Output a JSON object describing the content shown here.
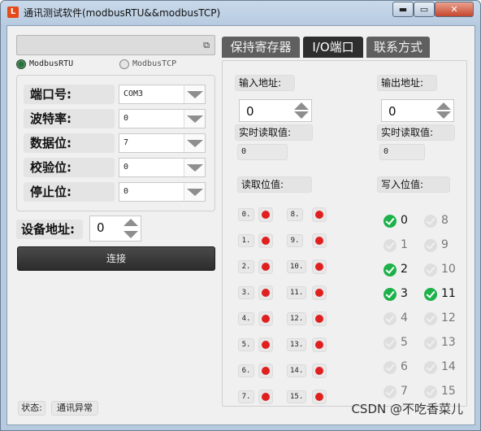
{
  "window": {
    "icon_glyph": "L",
    "title": "通讯测试软件(modbusRTU&&modbusTCP)",
    "min_glyph": "▬",
    "max_glyph": "▭",
    "close_glyph": "✕"
  },
  "left": {
    "combo_icon": "restore-icon",
    "restore_glyph": "⧉",
    "radios": {
      "rtu": "ModbusRTU",
      "tcp": "ModbusTCP",
      "selected": "ModbusRTU"
    },
    "serial": [
      {
        "label": "端口号:",
        "value": "COM3"
      },
      {
        "label": "波特率:",
        "value": "0"
      },
      {
        "label": "数据位:",
        "value": "7"
      },
      {
        "label": "校验位:",
        "value": "0"
      },
      {
        "label": "停止位:",
        "value": "0"
      }
    ],
    "device_address_label": "设备地址:",
    "device_address_value": "0",
    "connect_label": "连接",
    "status_label": "状态:",
    "status_value": "通讯异常"
  },
  "tabs": [
    "保持寄存器",
    "I/O端口",
    "联系方式"
  ],
  "active_tab": "I/O端口",
  "io": {
    "input_address_label": "输入地址:",
    "input_address_value": "0",
    "output_address_label": "输出地址:",
    "output_address_value": "0",
    "realtime_in_label": "实时读取值:",
    "realtime_in_value": "0",
    "realtime_out_label": "实时读取值:",
    "realtime_out_value": "0",
    "read_bits_label": "读取位值:",
    "write_bits_label": "写入位值:",
    "read_bits": [
      {
        "n": "0.",
        "on": true
      },
      {
        "n": "1.",
        "on": true
      },
      {
        "n": "2.",
        "on": true
      },
      {
        "n": "3.",
        "on": true
      },
      {
        "n": "4.",
        "on": true
      },
      {
        "n": "5.",
        "on": true
      },
      {
        "n": "6.",
        "on": true
      },
      {
        "n": "7.",
        "on": true
      },
      {
        "n": "8.",
        "on": true
      },
      {
        "n": "9.",
        "on": true
      },
      {
        "n": "10.",
        "on": true
      },
      {
        "n": "11.",
        "on": true
      },
      {
        "n": "12.",
        "on": true
      },
      {
        "n": "13.",
        "on": true
      },
      {
        "n": "14.",
        "on": true
      },
      {
        "n": "15.",
        "on": true
      }
    ],
    "write_bits": [
      {
        "n": "0",
        "checked": true
      },
      {
        "n": "1",
        "checked": false
      },
      {
        "n": "2",
        "checked": true
      },
      {
        "n": "3",
        "checked": true
      },
      {
        "n": "4",
        "checked": false
      },
      {
        "n": "5",
        "checked": false
      },
      {
        "n": "6",
        "checked": false
      },
      {
        "n": "7",
        "checked": false
      },
      {
        "n": "8",
        "checked": false
      },
      {
        "n": "9",
        "checked": false
      },
      {
        "n": "10",
        "checked": false
      },
      {
        "n": "11",
        "checked": true
      },
      {
        "n": "12",
        "checked": false
      },
      {
        "n": "13",
        "checked": false
      },
      {
        "n": "14",
        "checked": false
      },
      {
        "n": "15",
        "checked": false
      }
    ]
  },
  "colors": {
    "led_red": "#e01f1f",
    "check_green": "#1db14a",
    "tab_dark": "#2e2e2e",
    "tab_gray": "#5f5f5f"
  },
  "watermark": "CSDN @不吃香菜儿"
}
